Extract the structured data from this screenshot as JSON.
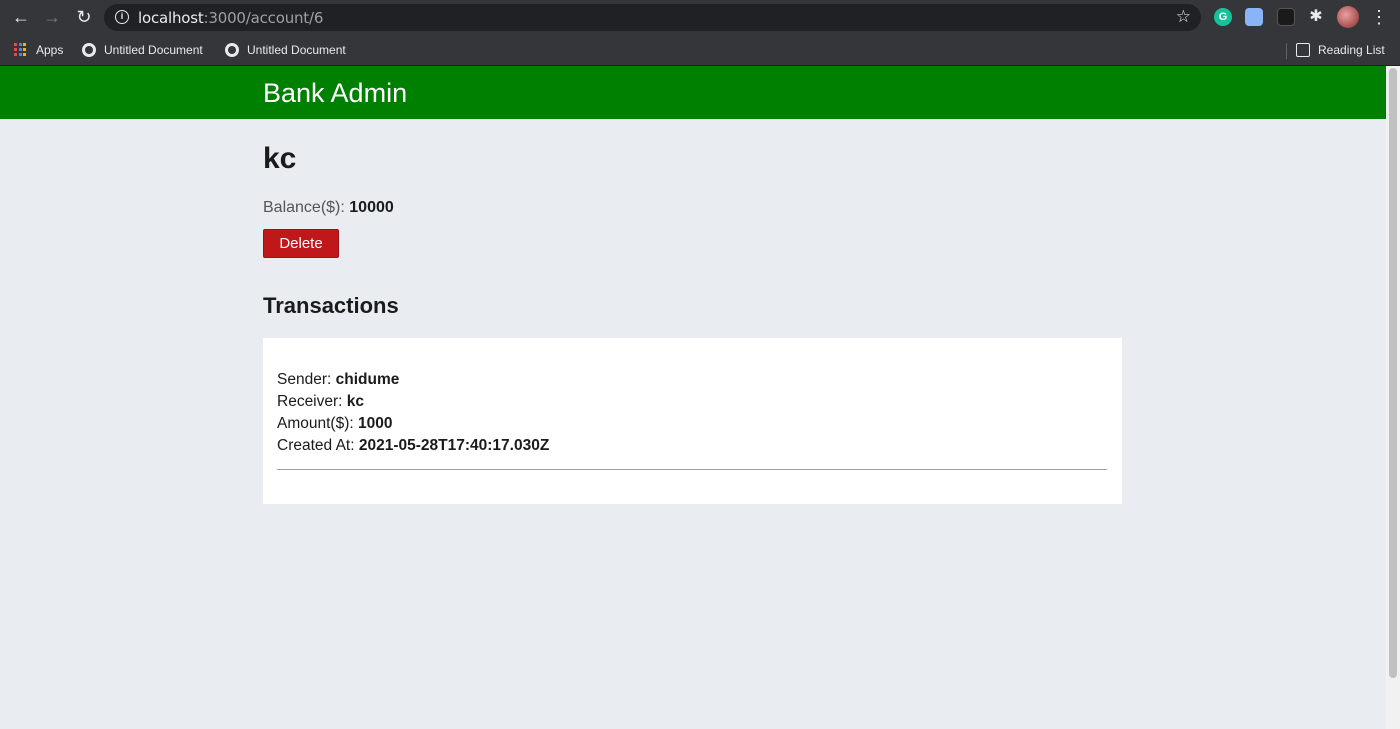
{
  "browser": {
    "url_host": "localhost",
    "url_path": ":3000/account/6",
    "bookmarks": [
      {
        "label": "Apps"
      },
      {
        "label": "Untitled Document"
      },
      {
        "label": "Untitled Document"
      }
    ],
    "reading_list": "Reading List"
  },
  "navbar": {
    "brand": "Bank Admin",
    "color": "#008000"
  },
  "account": {
    "name": "kc",
    "balance_label": "Balance($):",
    "balance_value": "10000",
    "delete_label": "Delete"
  },
  "transactions": {
    "heading": "Transactions",
    "items": [
      {
        "sender_label": "Sender:",
        "sender": "chidume",
        "receiver_label": "Receiver:",
        "receiver": "kc",
        "amount_label": "Amount($):",
        "amount": "1000",
        "created_label": "Created At:",
        "created_at": "2021-05-28T17:40:17.030Z"
      }
    ]
  },
  "colors": {
    "delete": "#c0171a",
    "page_bg": "#e9ecf1"
  }
}
